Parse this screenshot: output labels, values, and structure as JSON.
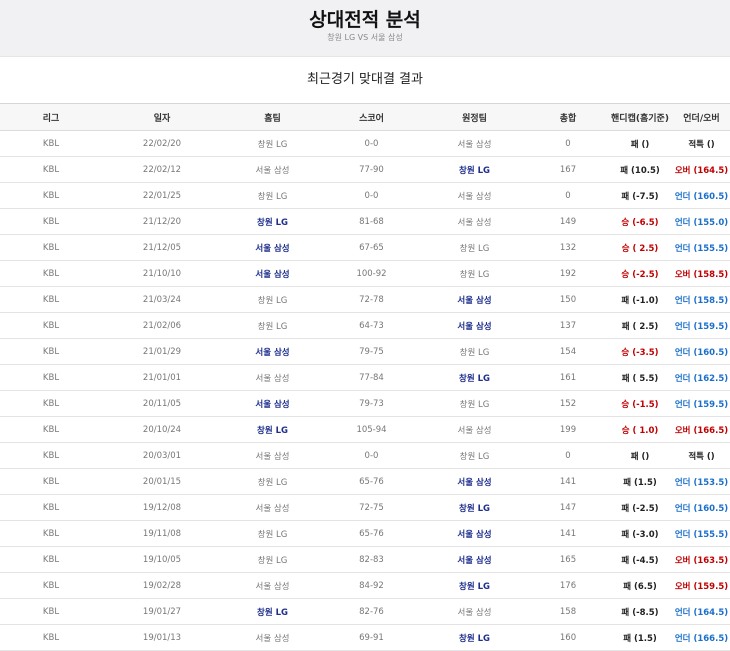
{
  "header": {
    "title": "상대전적 분석",
    "subtitle": "창원 LG VS 서울 삼성"
  },
  "section_title": "최근경기 맞대결 결과",
  "columns": [
    "리그",
    "일자",
    "홈팀",
    "스코어",
    "원정팀",
    "총합",
    "핸디캡(홈기준)",
    "언더/오버"
  ],
  "colors": {
    "win_team": "#1f2f8c",
    "over": "#c00000",
    "under": "#1a6fc9",
    "handicap_win": "#c00000"
  },
  "rows": [
    {
      "league": "KBL",
      "date": "22/02/20",
      "home": "창원 LG",
      "score": "0-0",
      "away": "서울 삼성",
      "total": "0",
      "hc": "패 ()",
      "ou": "적특 ()",
      "winner": "none",
      "hc_result": "loss",
      "ou_type": "push"
    },
    {
      "league": "KBL",
      "date": "22/02/12",
      "home": "서울 삼성",
      "score": "77-90",
      "away": "창원 LG",
      "total": "167",
      "hc": "패 (10.5)",
      "ou": "오버 (164.5)",
      "winner": "away",
      "hc_result": "loss",
      "ou_type": "over"
    },
    {
      "league": "KBL",
      "date": "22/01/25",
      "home": "창원 LG",
      "score": "0-0",
      "away": "서울 삼성",
      "total": "0",
      "hc": "패 (-7.5)",
      "ou": "언더 (160.5)",
      "winner": "none",
      "hc_result": "loss",
      "ou_type": "under"
    },
    {
      "league": "KBL",
      "date": "21/12/20",
      "home": "창원 LG",
      "score": "81-68",
      "away": "서울 삼성",
      "total": "149",
      "hc": "승 (-6.5)",
      "ou": "언더 (155.0)",
      "winner": "home",
      "hc_result": "win",
      "ou_type": "under"
    },
    {
      "league": "KBL",
      "date": "21/12/05",
      "home": "서울 삼성",
      "score": "67-65",
      "away": "창원 LG",
      "total": "132",
      "hc": "승 ( 2.5)",
      "ou": "언더 (155.5)",
      "winner": "home",
      "hc_result": "win",
      "ou_type": "under"
    },
    {
      "league": "KBL",
      "date": "21/10/10",
      "home": "서울 삼성",
      "score": "100-92",
      "away": "창원 LG",
      "total": "192",
      "hc": "승 (-2.5)",
      "ou": "오버 (158.5)",
      "winner": "home",
      "hc_result": "win",
      "ou_type": "over"
    },
    {
      "league": "KBL",
      "date": "21/03/24",
      "home": "창원 LG",
      "score": "72-78",
      "away": "서울 삼성",
      "total": "150",
      "hc": "패 (-1.0)",
      "ou": "언더 (158.5)",
      "winner": "away",
      "hc_result": "loss",
      "ou_type": "under"
    },
    {
      "league": "KBL",
      "date": "21/02/06",
      "home": "창원 LG",
      "score": "64-73",
      "away": "서울 삼성",
      "total": "137",
      "hc": "패 ( 2.5)",
      "ou": "언더 (159.5)",
      "winner": "away",
      "hc_result": "loss",
      "ou_type": "under"
    },
    {
      "league": "KBL",
      "date": "21/01/29",
      "home": "서울 삼성",
      "score": "79-75",
      "away": "창원 LG",
      "total": "154",
      "hc": "승 (-3.5)",
      "ou": "언더 (160.5)",
      "winner": "home",
      "hc_result": "win",
      "ou_type": "under"
    },
    {
      "league": "KBL",
      "date": "21/01/01",
      "home": "서울 삼성",
      "score": "77-84",
      "away": "창원 LG",
      "total": "161",
      "hc": "패 ( 5.5)",
      "ou": "언더 (162.5)",
      "winner": "away",
      "hc_result": "loss",
      "ou_type": "under"
    },
    {
      "league": "KBL",
      "date": "20/11/05",
      "home": "서울 삼성",
      "score": "79-73",
      "away": "창원 LG",
      "total": "152",
      "hc": "승 (-1.5)",
      "ou": "언더 (159.5)",
      "winner": "home",
      "hc_result": "win",
      "ou_type": "under"
    },
    {
      "league": "KBL",
      "date": "20/10/24",
      "home": "창원 LG",
      "score": "105-94",
      "away": "서울 삼성",
      "total": "199",
      "hc": "승 ( 1.0)",
      "ou": "오버 (166.5)",
      "winner": "home",
      "hc_result": "win",
      "ou_type": "over"
    },
    {
      "league": "KBL",
      "date": "20/03/01",
      "home": "서울 삼성",
      "score": "0-0",
      "away": "창원 LG",
      "total": "0",
      "hc": "패 ()",
      "ou": "적특 ()",
      "winner": "none",
      "hc_result": "loss",
      "ou_type": "push"
    },
    {
      "league": "KBL",
      "date": "20/01/15",
      "home": "창원 LG",
      "score": "65-76",
      "away": "서울 삼성",
      "total": "141",
      "hc": "패 (1.5)",
      "ou": "언더 (153.5)",
      "winner": "away",
      "hc_result": "loss",
      "ou_type": "under"
    },
    {
      "league": "KBL",
      "date": "19/12/08",
      "home": "서울 삼성",
      "score": "72-75",
      "away": "창원 LG",
      "total": "147",
      "hc": "패 (-2.5)",
      "ou": "언더 (160.5)",
      "winner": "away",
      "hc_result": "loss",
      "ou_type": "under"
    },
    {
      "league": "KBL",
      "date": "19/11/08",
      "home": "창원 LG",
      "score": "65-76",
      "away": "서울 삼성",
      "total": "141",
      "hc": "패 (-3.0)",
      "ou": "언더 (155.5)",
      "winner": "away",
      "hc_result": "loss",
      "ou_type": "under"
    },
    {
      "league": "KBL",
      "date": "19/10/05",
      "home": "창원 LG",
      "score": "82-83",
      "away": "서울 삼성",
      "total": "165",
      "hc": "패 (-4.5)",
      "ou": "오버 (163.5)",
      "winner": "away",
      "hc_result": "loss",
      "ou_type": "over"
    },
    {
      "league": "KBL",
      "date": "19/02/28",
      "home": "서울 삼성",
      "score": "84-92",
      "away": "창원 LG",
      "total": "176",
      "hc": "패 (6.5)",
      "ou": "오버 (159.5)",
      "winner": "away",
      "hc_result": "loss",
      "ou_type": "over"
    },
    {
      "league": "KBL",
      "date": "19/01/27",
      "home": "창원 LG",
      "score": "82-76",
      "away": "서울 삼성",
      "total": "158",
      "hc": "패 (-8.5)",
      "ou": "언더 (164.5)",
      "winner": "home",
      "hc_result": "loss",
      "ou_type": "under"
    },
    {
      "league": "KBL",
      "date": "19/01/13",
      "home": "서울 삼성",
      "score": "69-91",
      "away": "창원 LG",
      "total": "160",
      "hc": "패 (1.5)",
      "ou": "언더 (166.5)",
      "winner": "away",
      "hc_result": "loss",
      "ou_type": "under"
    }
  ]
}
